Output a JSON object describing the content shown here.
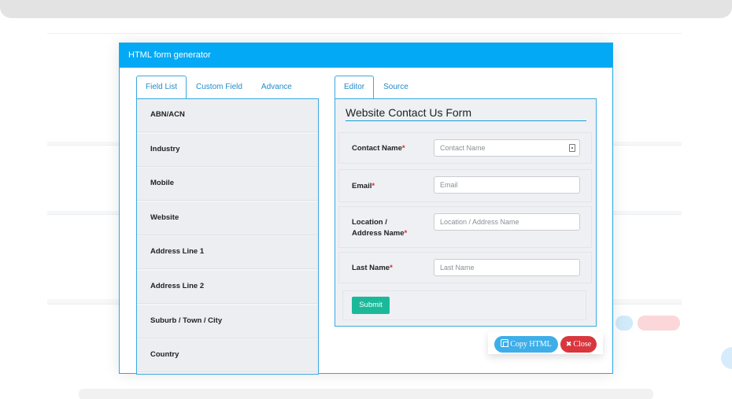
{
  "modal": {
    "title": "HTML form generator",
    "left_tabs": [
      "Field List",
      "Custom Field",
      "Advance"
    ],
    "right_tabs": [
      "Editor",
      "Source"
    ],
    "field_list": [
      "ABN/ACN",
      "Industry",
      "Mobile",
      "Website",
      "Address Line 1",
      "Address Line 2",
      "Suburb / Town / City",
      "Country"
    ],
    "form": {
      "title": "Website Contact Us Form",
      "fields": [
        {
          "label": "Contact Name",
          "required_mark": "*",
          "placeholder": "Contact Name"
        },
        {
          "label": "Email",
          "required_mark": "*",
          "placeholder": "Email"
        },
        {
          "label_line1": "Location /",
          "label_line2": "Address Name",
          "required_mark": "*",
          "placeholder": "Location / Address Name"
        },
        {
          "label": "Last Name",
          "required_mark": "*",
          "placeholder": "Last Name"
        }
      ],
      "submit_label": "Submit"
    },
    "copy_label": "Copy HTML",
    "close_label": "Close"
  },
  "colors": {
    "header": "#03a9f4",
    "submit": "#1bb99a",
    "copy": "#3eaee8",
    "close": "#d9363e"
  },
  "icons": [
    "copy-icon",
    "close-x-icon",
    "contact-card-icon"
  ]
}
